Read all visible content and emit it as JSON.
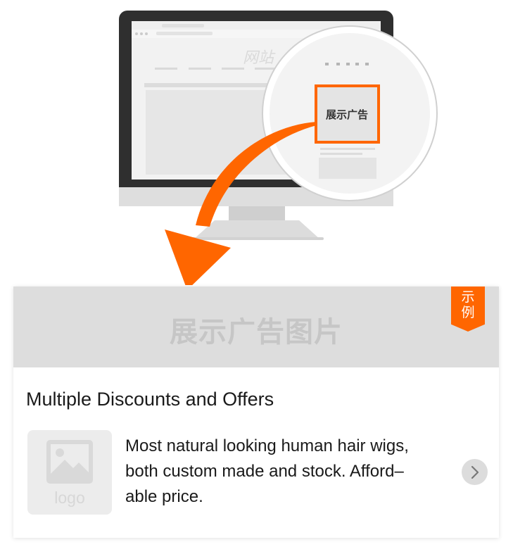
{
  "illustration": {
    "site_watermark": "网站",
    "display_ad_label": "展示广告",
    "colors": {
      "accent": "#ff6600",
      "monitor_bezel": "#2f2f2f",
      "monitor_stand": "#dddddd"
    }
  },
  "ad": {
    "banner_text": "展示广告图片",
    "sample_badge": [
      "示",
      "例"
    ],
    "title": "Multiple Discounts and Offers",
    "logo_text": "logo",
    "description_lines": [
      "Most natural looking human hair wigs,",
      "both custom made and stock. Afford–",
      "able price."
    ],
    "icons": {
      "logo": "image-placeholder-icon",
      "more": "chevron-right-icon"
    },
    "colors": {
      "banner": "#dddddd",
      "badge": "#ff6600",
      "text": "#1a1a1a"
    }
  }
}
